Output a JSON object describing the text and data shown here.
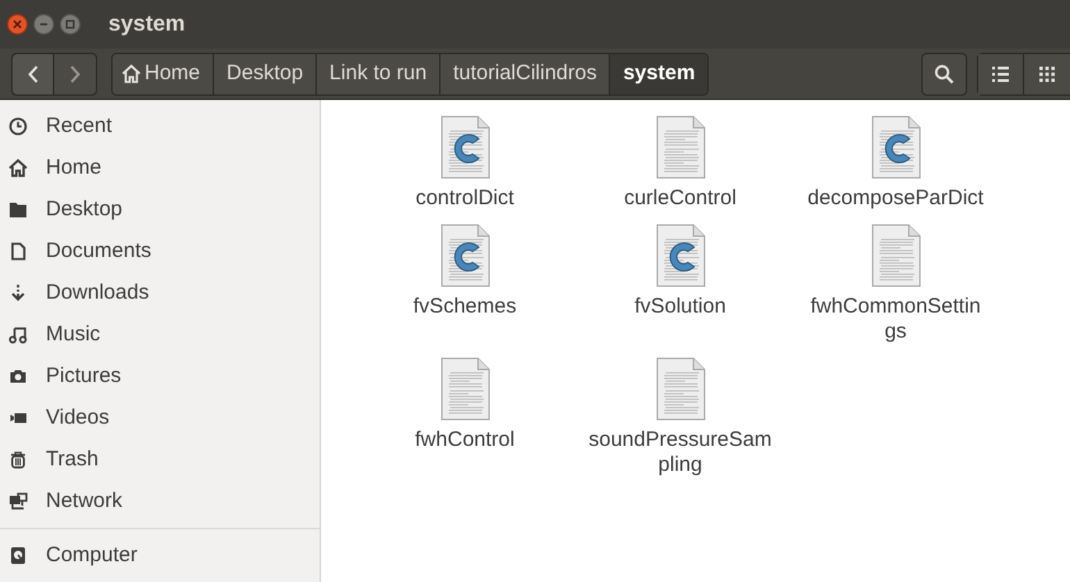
{
  "window": {
    "title": "system"
  },
  "path": [
    {
      "label": "Home",
      "kind": "home",
      "selected": false
    },
    {
      "label": "Desktop",
      "kind": "folder",
      "selected": false
    },
    {
      "label": "Link to run",
      "kind": "folder",
      "selected": false
    },
    {
      "label": "tutorialCilindros",
      "kind": "folder",
      "selected": false
    },
    {
      "label": "system",
      "kind": "folder",
      "selected": true
    }
  ],
  "sidebar": {
    "places": [
      {
        "label": "Recent",
        "kind": "recent"
      },
      {
        "label": "Home",
        "kind": "home"
      },
      {
        "label": "Desktop",
        "kind": "desktop"
      },
      {
        "label": "Documents",
        "kind": "documents"
      },
      {
        "label": "Downloads",
        "kind": "downloads"
      },
      {
        "label": "Music",
        "kind": "music"
      },
      {
        "label": "Pictures",
        "kind": "pictures"
      },
      {
        "label": "Videos",
        "kind": "videos"
      },
      {
        "label": "Trash",
        "kind": "trash"
      },
      {
        "label": "Network",
        "kind": "network"
      }
    ],
    "devices": [
      {
        "label": "Computer",
        "kind": "computer"
      }
    ]
  },
  "files": [
    {
      "name_lines": [
        "controlDict"
      ],
      "kind": "c"
    },
    {
      "name_lines": [
        "curleControl"
      ],
      "kind": "text"
    },
    {
      "name_lines": [
        "decomposeParDict"
      ],
      "kind": "c"
    },
    {
      "name_lines": [
        "fvSchemes"
      ],
      "kind": "c"
    },
    {
      "name_lines": [
        "fvSolution"
      ],
      "kind": "c"
    },
    {
      "name_lines": [
        "fwhCommonSettin",
        "gs"
      ],
      "kind": "text"
    },
    {
      "name_lines": [
        "fwhControl"
      ],
      "kind": "text"
    },
    {
      "name_lines": [
        "soundPressureSam",
        "pling"
      ],
      "kind": "text"
    }
  ]
}
